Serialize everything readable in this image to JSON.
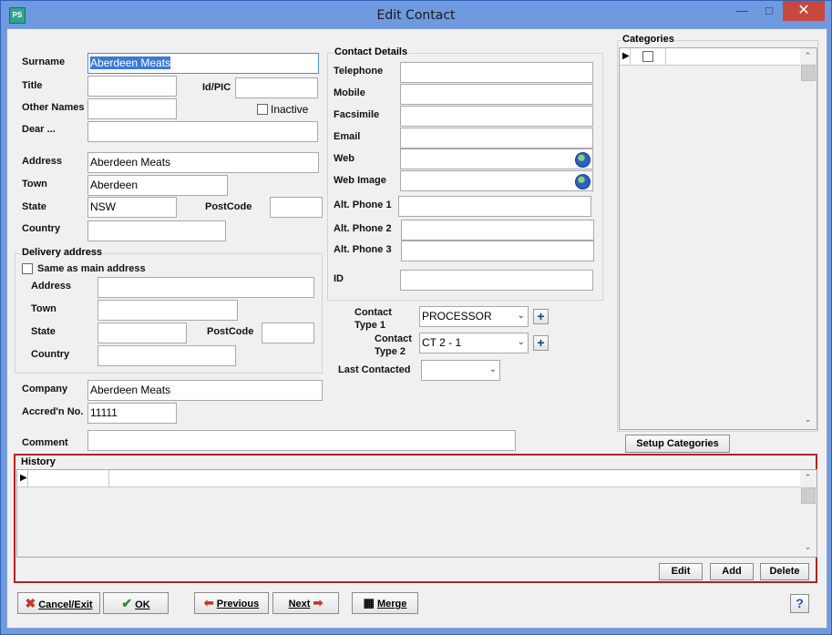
{
  "window": {
    "title": "Edit Contact",
    "app_icon_text": "PS"
  },
  "left": {
    "surname_label": "Surname",
    "surname_value": "Aberdeen Meats",
    "title_label": "Title",
    "title_value": "",
    "idpic_label": "Id/PIC",
    "idpic_value": "",
    "other_names_label": "Other Names",
    "other_names_value": "",
    "inactive_label": "Inactive",
    "dear_label": "Dear ...",
    "dear_value": "",
    "address_label": "Address",
    "address_value": "Aberdeen Meats",
    "town_label": "Town",
    "town_value": "Aberdeen",
    "state_label": "State",
    "state_value": "NSW",
    "postcode_label": "PostCode",
    "postcode_value": "",
    "country_label": "Country",
    "country_value": ""
  },
  "delivery": {
    "group_title": "Delivery address",
    "same_label": "Same as main address",
    "address_label": "Address",
    "address_value": "",
    "town_label": "Town",
    "town_value": "",
    "state_label": "State",
    "state_value": "",
    "postcode_label": "PostCode",
    "postcode_value": "",
    "country_label": "Country",
    "country_value": ""
  },
  "company": {
    "company_label": "Company",
    "company_value": "Aberdeen Meats",
    "accred_label": "Accred'n No.",
    "accred_value": "11111",
    "comment_label": "Comment",
    "comment_value": ""
  },
  "contact_details": {
    "group_title": "Contact Details",
    "telephone_label": "Telephone",
    "telephone_value": "",
    "mobile_label": "Mobile",
    "mobile_value": "",
    "facsimile_label": "Facsimile",
    "facsimile_value": "",
    "email_label": "Email",
    "email_value": "",
    "web_label": "Web",
    "web_value": "",
    "web_image_label": "Web Image",
    "web_image_value": "",
    "alt1_label": "Alt. Phone 1",
    "alt1_value": "",
    "alt2_label": "Alt. Phone 2",
    "alt2_value": "",
    "alt3_label": "Alt. Phone 3",
    "alt3_value": "",
    "id_label": "ID",
    "id_value": ""
  },
  "contact_type": {
    "type1_label_1": "Contact",
    "type1_label_2": "Type 1",
    "type1_value": "PROCESSOR",
    "type2_label_1": "Contact",
    "type2_label_2": "Type 2",
    "type2_value": "CT 2 - 1",
    "last_contacted_label": "Last Contacted",
    "last_contacted_value": ""
  },
  "categories": {
    "group_title": "Categories",
    "setup_button": "Setup Categories"
  },
  "history": {
    "group_title": "History",
    "edit_button": "Edit",
    "add_button": "Add",
    "delete_button": "Delete"
  },
  "footer": {
    "cancel_label": "Cancel/Exit",
    "ok_label": "OK",
    "previous_label": "Previous",
    "next_label": "Next",
    "merge_label": "Merge",
    "help_label": "?"
  },
  "icons": {
    "minimize": "minimize-icon",
    "maximize": "maximize-icon",
    "close": "close-icon",
    "globe": "globe-icon",
    "plus": "plus-icon",
    "cancel": "cross-icon",
    "ok": "check-icon",
    "previous": "left-arrow-icon",
    "next": "right-arrow-icon",
    "merge": "merge-icon",
    "help": "help-icon"
  },
  "colors": {
    "titlebar": "#6f9ae0",
    "close": "#c7483f",
    "history_border": "#b22222",
    "selection": "#3a7bd5"
  }
}
